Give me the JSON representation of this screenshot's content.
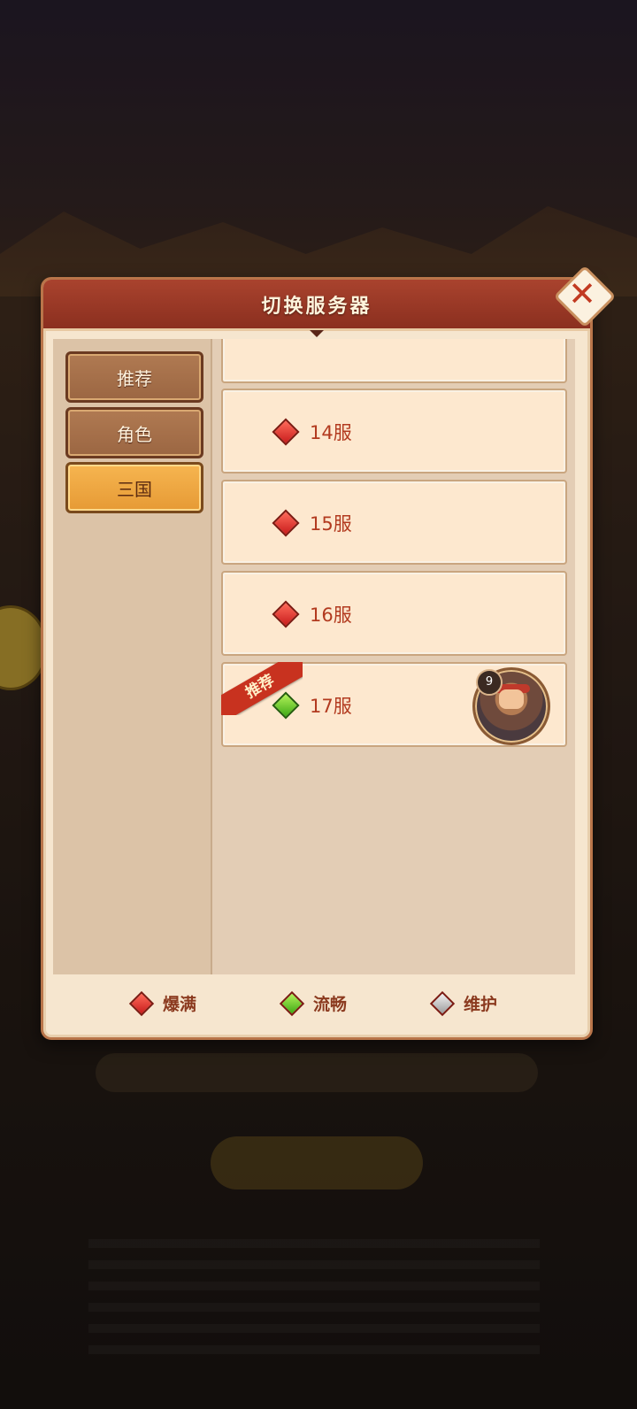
{
  "dialog": {
    "title": "切换服务器"
  },
  "tabs": [
    {
      "label": "推荐",
      "active": false
    },
    {
      "label": "角色",
      "active": false
    },
    {
      "label": "三国",
      "active": true
    }
  ],
  "servers": [
    {
      "name": "14服",
      "status": "爆满",
      "recommended": false
    },
    {
      "name": "15服",
      "status": "爆满",
      "recommended": false
    },
    {
      "name": "16服",
      "status": "爆满",
      "recommended": false
    },
    {
      "name": "17服",
      "status": "流畅",
      "recommended": true,
      "ribbon": "推荐",
      "character_level": "9"
    }
  ],
  "legend": [
    {
      "label": "爆满",
      "color": "#d9352a"
    },
    {
      "label": "流畅",
      "color": "#55b920"
    },
    {
      "label": "维护",
      "color": "#b0b0b0"
    }
  ],
  "colors": {
    "header": "#9b3a27",
    "panel": "#f6e6cf",
    "accent_tab": "#f2a743"
  },
  "icons": {
    "close": "close-icon",
    "status": "diamond-icon"
  }
}
